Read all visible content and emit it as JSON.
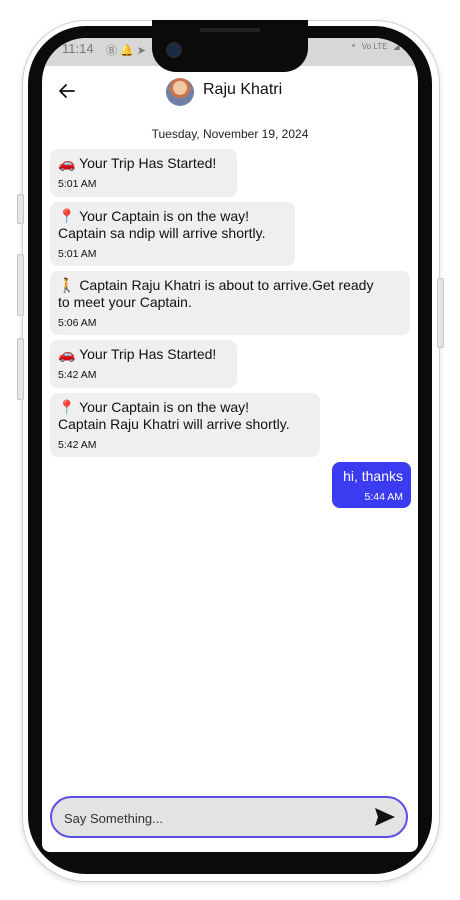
{
  "status_bar": {
    "time": "11:14",
    "network": "Vo LTE"
  },
  "header": {
    "back_icon": "arrow-left-icon",
    "contact_name": "Raju Khatri"
  },
  "chat": {
    "date": "Tuesday, November 19, 2024",
    "messages": [
      {
        "text": "🚗 Your Trip Has Started!",
        "time": "5:01 AM",
        "sent": false
      },
      {
        "text": "📍 Your Captain is on the way!\nCaptain sa ndip will arrive shortly.",
        "time": "5:01 AM",
        "sent": false
      },
      {
        "text": "🚶 Captain Raju Khatri is about to arrive.Get ready\nto meet your Captain.",
        "time": "5:06 AM",
        "sent": false
      },
      {
        "text": "🚗 Your Trip Has Started!",
        "time": "5:42 AM",
        "sent": false
      },
      {
        "text": "📍 Your Captain is on the way!\nCaptain Raju Khatri will arrive shortly.",
        "time": "5:42 AM",
        "sent": false
      },
      {
        "text": "hi, thanks",
        "time": "5:44 AM",
        "sent": true
      }
    ]
  },
  "composer": {
    "placeholder": "Say Something...",
    "send_icon": "send-icon"
  },
  "colors": {
    "sent_bubble": "#3b3bf2",
    "received_bubble": "#efefef",
    "input_border": "#5a4fe6"
  }
}
